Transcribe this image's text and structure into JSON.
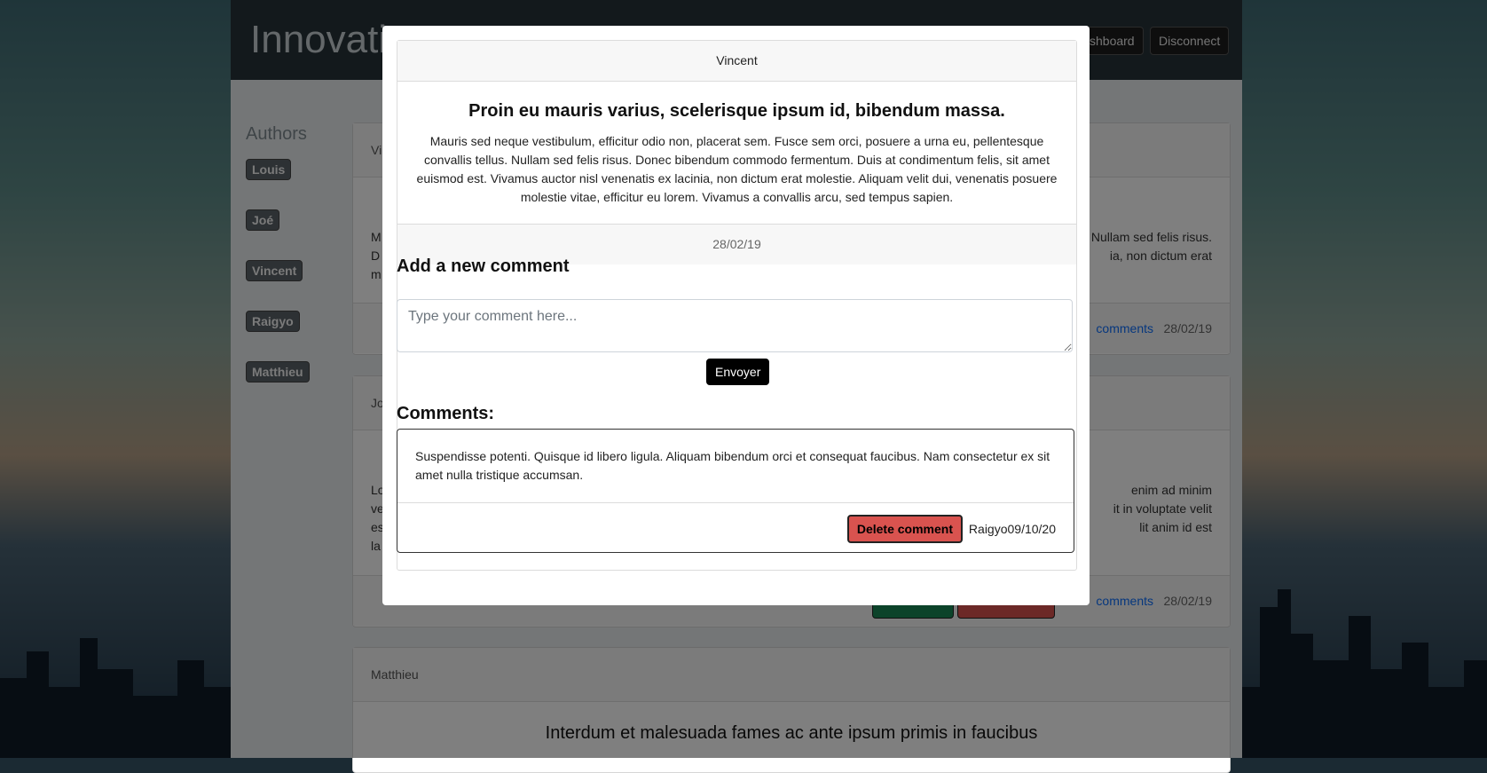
{
  "app": {
    "brand": "Innovati",
    "nav": {
      "dashboard_label": "shboard",
      "disconnect_label": "Disconnect"
    }
  },
  "sidebar": {
    "title": "Authors",
    "authors": [
      "Louis",
      "Joé",
      "Vincent",
      "Raigyo",
      "Matthieu"
    ]
  },
  "background_posts": [
    {
      "header": "Vi",
      "text_left": "M\nD\nm",
      "text_right": "Nullam sed felis risus.\nia, non dictum erat",
      "comments_link": "comments",
      "date": "28/02/19"
    },
    {
      "header": "Jo",
      "text_left": "Lo\nve\nes\nla",
      "text_right": "enim ad minim\nit in voluptate velit\nlit anim id est",
      "comments_link": "comments",
      "date": "28/02/19"
    },
    {
      "header": "Matthieu",
      "title": "Interdum et malesuada fames ac ante ipsum primis in faucibus"
    }
  ],
  "modal": {
    "author": "Vincent",
    "title": "Proin eu mauris varius, scelerisque ipsum id, bibendum massa.",
    "body": "Mauris sed neque vestibulum, efficitur odio non, placerat sem. Fusce sem orci, posuere a urna eu, pellentesque convallis tellus. Nullam sed felis risus. Donec bibendum commodo fermentum. Duis at condimentum felis, sit amet euismod est. Vivamus auctor nisl venenatis ex lacinia, non dictum erat molestie. Aliquam velit dui, venenatis posuere molestie vitae, efficitur eu lorem. Vivamus a convallis arcu, sed tempus sapien.",
    "date": "28/02/19",
    "add_comment_title": "Add a new comment",
    "comment_placeholder": "Type your comment here...",
    "comment_value": "",
    "send_label": "Envoyer",
    "comments_title": "Comments:",
    "comments": [
      {
        "text": "Suspendisse potenti. Quisque id libero ligula. Aliquam bibendum orci et consequat faucibus. Nam consectetur ex sit amet nulla tristique accumsan.",
        "delete_label": "Delete comment",
        "meta": "Raigyo09/10/20"
      }
    ]
  },
  "colors": {
    "delete": "#d9534f",
    "send": "#000000",
    "link": "#0d6efd"
  }
}
